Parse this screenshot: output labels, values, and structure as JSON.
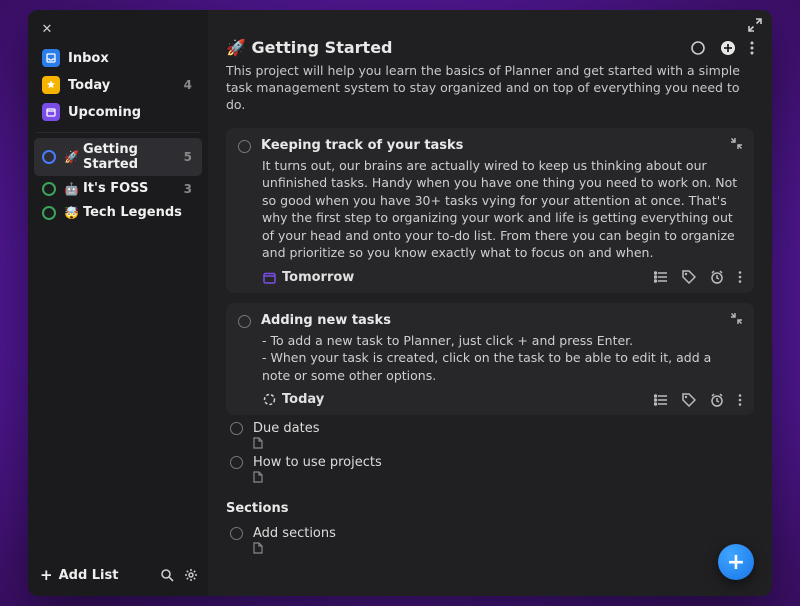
{
  "sidebar": {
    "nav": {
      "inbox": {
        "label": "Inbox"
      },
      "today": {
        "label": "Today",
        "count": "4"
      },
      "upcoming": {
        "label": "Upcoming"
      }
    },
    "projects": [
      {
        "label": "Getting Started",
        "emoji": "🚀",
        "count": "5",
        "color": "#4a7aff",
        "active": true
      },
      {
        "label": "It's FOSS",
        "emoji": "🤖",
        "count": "3",
        "color": "#3aa35a"
      },
      {
        "label": "Tech Legends",
        "emoji": "🤯",
        "count": "",
        "color": "#3aa35a"
      }
    ],
    "add_list_label": "Add List"
  },
  "project": {
    "title_emoji": "🚀",
    "title": "Getting Started",
    "description": "This project will help you learn the basics of Planner and get started with a simple task management system to stay organized and on top of everything you need to do.",
    "tasks": [
      {
        "title": "Keeping track of your tasks",
        "body": "It turns out, our brains are actually wired to keep us thinking about our unfinished tasks. Handy when you have one thing you need to work on. Not so good when you have 30+ tasks vying for your attention at once. That's why the first step to organizing your work and life is getting everything out of your head and onto your to-do list. From there you can begin to organize and prioritize so you know exactly what to focus on and when.",
        "due": "Tomorrow",
        "due_icon": "calendar",
        "due_color": "#7a4de8"
      },
      {
        "title": "Adding new tasks",
        "body": "- To add a new task to Planner, just click + and press Enter.\n- When your task is created, click on the task to be able to edit it, add a note or some other options.",
        "due": "Today",
        "due_icon": "radial",
        "due_color": "#cfcfcf"
      }
    ],
    "simple_tasks": [
      {
        "title": "Due dates"
      },
      {
        "title": "How to use projects"
      }
    ],
    "sections": [
      {
        "name": "Sections",
        "tasks": [
          {
            "title": "Add sections"
          }
        ]
      }
    ]
  }
}
